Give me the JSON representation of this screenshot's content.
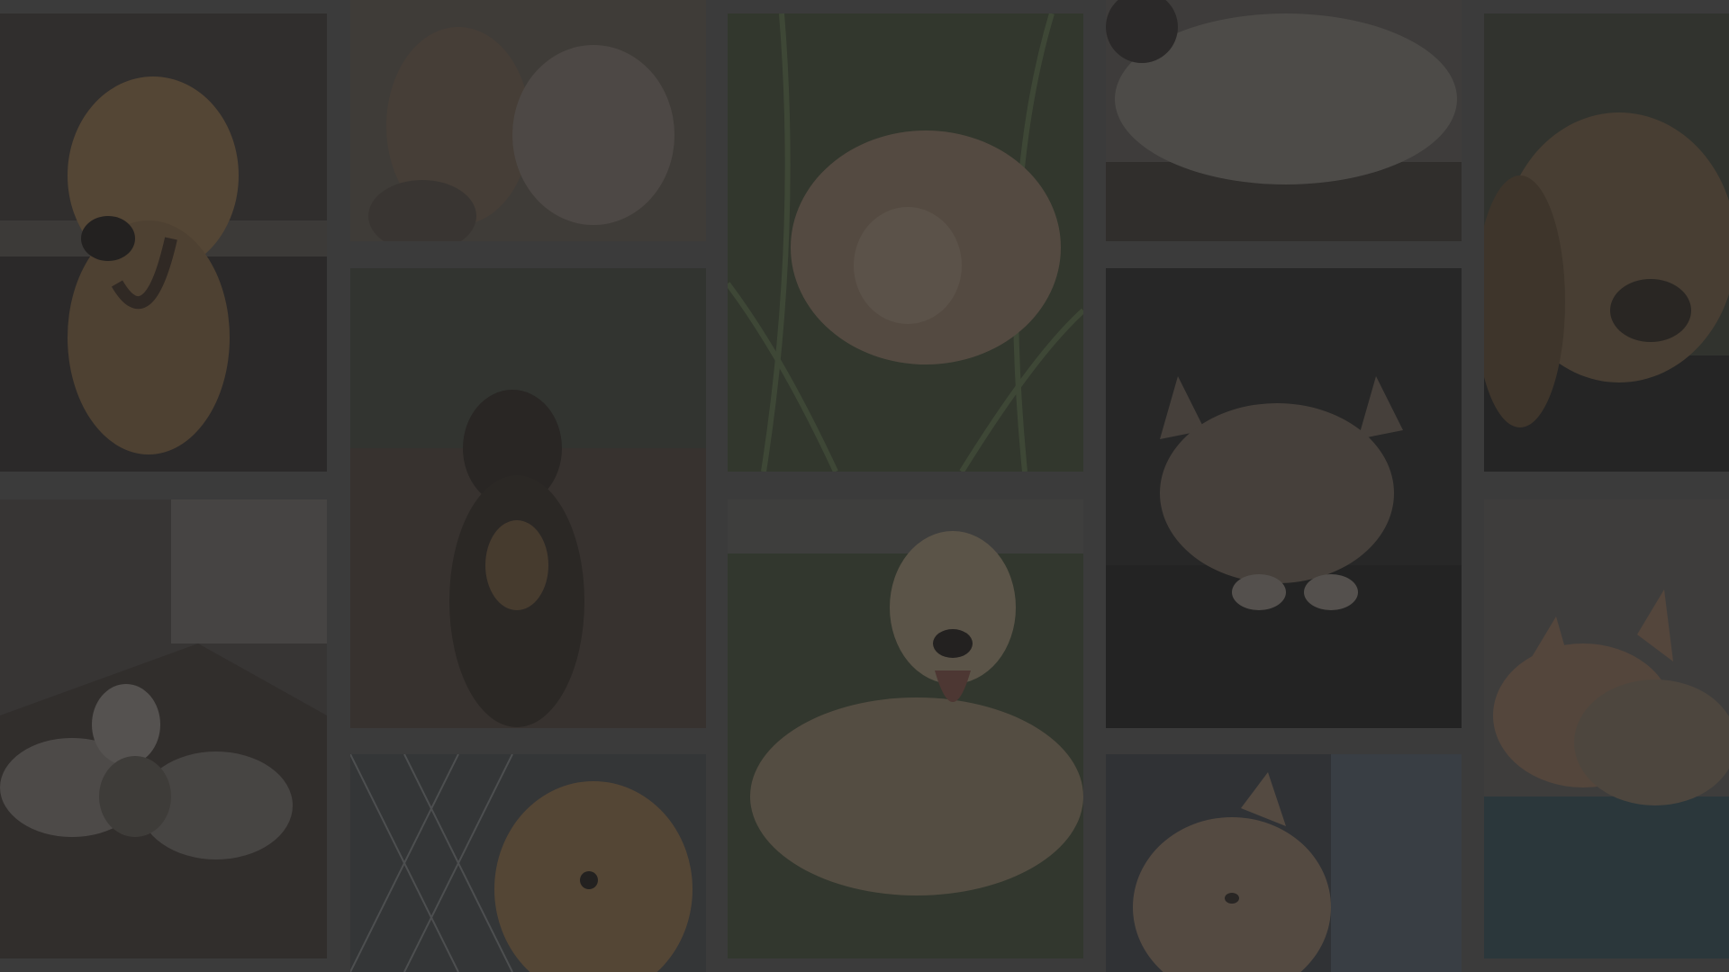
{
  "gallery": {
    "tiles": [
      {
        "subject": "dog-photo",
        "accent": "#8a6a45"
      },
      {
        "subject": "cat-photo",
        "accent": "#6b5a4a"
      },
      {
        "subject": "cat-photo",
        "accent": "#5f574f"
      },
      {
        "subject": "dog-photo",
        "accent": "#3d3a30"
      },
      {
        "subject": "dog-photo",
        "accent": "#6e5236"
      },
      {
        "subject": "cat-photo",
        "accent": "#4d5a3e"
      },
      {
        "subject": "dog-photo",
        "accent": "#7a6a55"
      },
      {
        "subject": "cat-photo",
        "accent": "#5e5a55"
      },
      {
        "subject": "cat-photo",
        "accent": "#2e2e2e"
      },
      {
        "subject": "cat-photo",
        "accent": "#7a6a5a"
      },
      {
        "subject": "dog-photo",
        "accent": "#6f5a40"
      },
      {
        "subject": "cat-photo",
        "accent": "#6a5545"
      }
    ],
    "colors": {
      "background": "#3b3b3b",
      "overlay": "#282828"
    }
  }
}
